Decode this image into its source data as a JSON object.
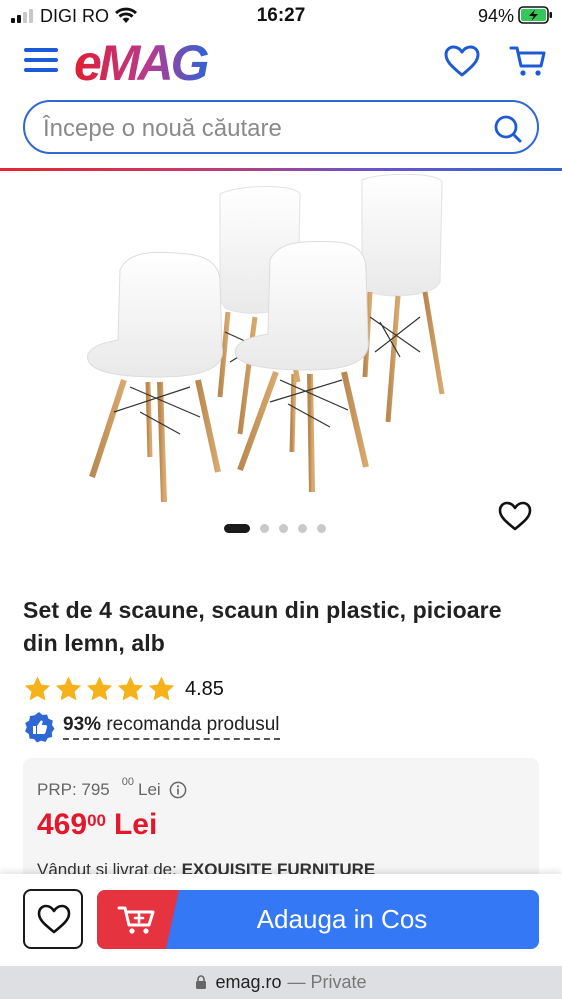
{
  "status_bar": {
    "carrier": "DIGI RO",
    "time": "16:27",
    "battery": "94%"
  },
  "header": {
    "logo_text": "eMAG",
    "search": {
      "placeholder": "Începe o nouă căutare",
      "value": ""
    }
  },
  "gallery": {
    "image_count": 5,
    "active_index": 0
  },
  "product": {
    "title": "Set de 4 scaune, scaun din plastic, picioare din lemn, alb",
    "rating": "4.85",
    "stars_filled": 5,
    "recommend_pct": "93%",
    "recommend_text": "recomanda produsul"
  },
  "pricing": {
    "prp_label": "PRP: 795",
    "prp_decimals": "00",
    "prp_currency": "Lei",
    "price_int": "469",
    "price_dec": "00",
    "price_currency": "Lei",
    "seller_label": "Vândut și livrat de:",
    "seller_name": "EXQUISITE FURNITURE"
  },
  "bottom_bar": {
    "add_to_cart": "Adauga in Cos"
  },
  "browser": {
    "domain": "emag.ro",
    "mode": "— Private"
  },
  "colors": {
    "brand_blue": "#2d68d3",
    "brand_red": "#e3182d",
    "star": "#f6b21a",
    "cta_blue": "#3478f6",
    "cta_red": "#e53340"
  }
}
